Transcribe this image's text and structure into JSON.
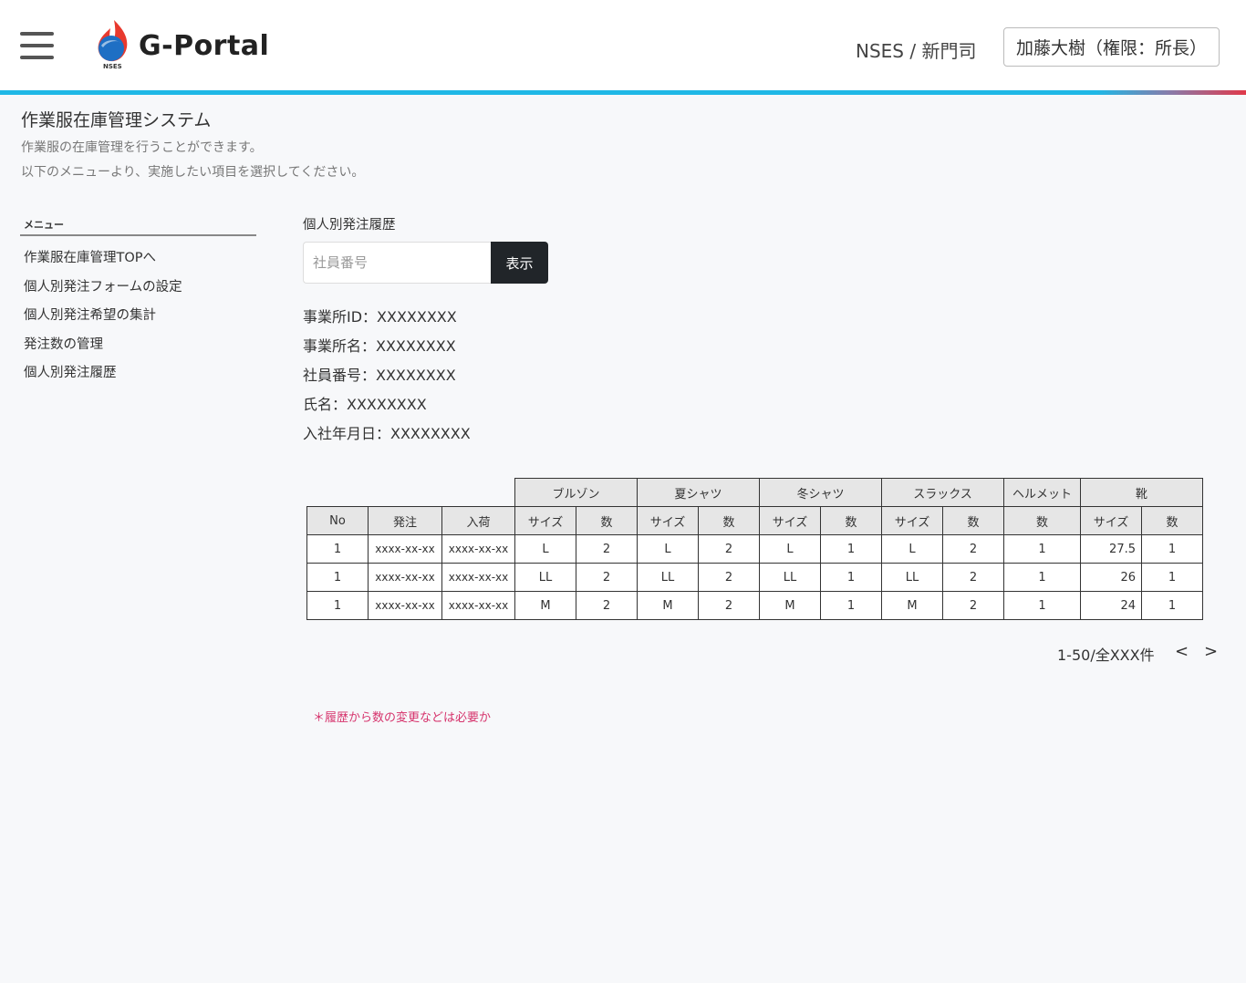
{
  "header": {
    "logo_text": "G-Portal",
    "logo_sub": "NSES",
    "office": "NSES / 新門司",
    "user": "加藤大樹（権限：所長）",
    "accent_color": "#1fb8e6"
  },
  "page": {
    "title": "作業服在庫管理システム",
    "desc1": "作業服の在庫管理を行うことができます。",
    "desc2": "以下のメニューより、実施したい項目を選択してください。"
  },
  "menu": {
    "heading": "メニュー",
    "items": [
      "作業服在庫管理TOPへ",
      "個人別発注フォームの設定",
      "個人別発注希望の集計",
      "発注数の管理",
      "個人別発注履歴"
    ]
  },
  "main": {
    "section_label": "個人別発注履歴",
    "search_placeholder": "社員番号",
    "show_button": "表示",
    "info": {
      "office_id": "事業所ID：XXXXXXXX",
      "office_name": "事業所名：XXXXXXXX",
      "employee_no": "社員番号：XXXXXXXX",
      "name": "氏名：XXXXXXXX",
      "join_date": "入社年月日：XXXXXXXX"
    },
    "table": {
      "groups": [
        "ブルゾン",
        "夏シャツ",
        "冬シャツ",
        "スラックス",
        "ヘルメット",
        "靴"
      ],
      "headers": [
        "No",
        "発注",
        "入荷",
        "サイズ",
        "数",
        "サイズ",
        "数",
        "サイズ",
        "数",
        "サイズ",
        "数",
        "数",
        "サイズ",
        "数"
      ],
      "rows": [
        [
          "1",
          "xxxx-xx-xx",
          "xxxx-xx-xx",
          "L",
          "2",
          "L",
          "2",
          "L",
          "1",
          "L",
          "2",
          "1",
          "27.5",
          "1"
        ],
        [
          "1",
          "xxxx-xx-xx",
          "xxxx-xx-xx",
          "LL",
          "2",
          "LL",
          "2",
          "LL",
          "1",
          "LL",
          "2",
          "1",
          "26",
          "1"
        ],
        [
          "1",
          "xxxx-xx-xx",
          "xxxx-xx-xx",
          "M",
          "2",
          "M",
          "2",
          "M",
          "1",
          "M",
          "2",
          "1",
          "24",
          "1"
        ]
      ]
    },
    "pager": {
      "text": "1-50/全XXX件",
      "prev": "<",
      "next": ">"
    },
    "note": "＊履歴から数の変更などは必要か"
  }
}
